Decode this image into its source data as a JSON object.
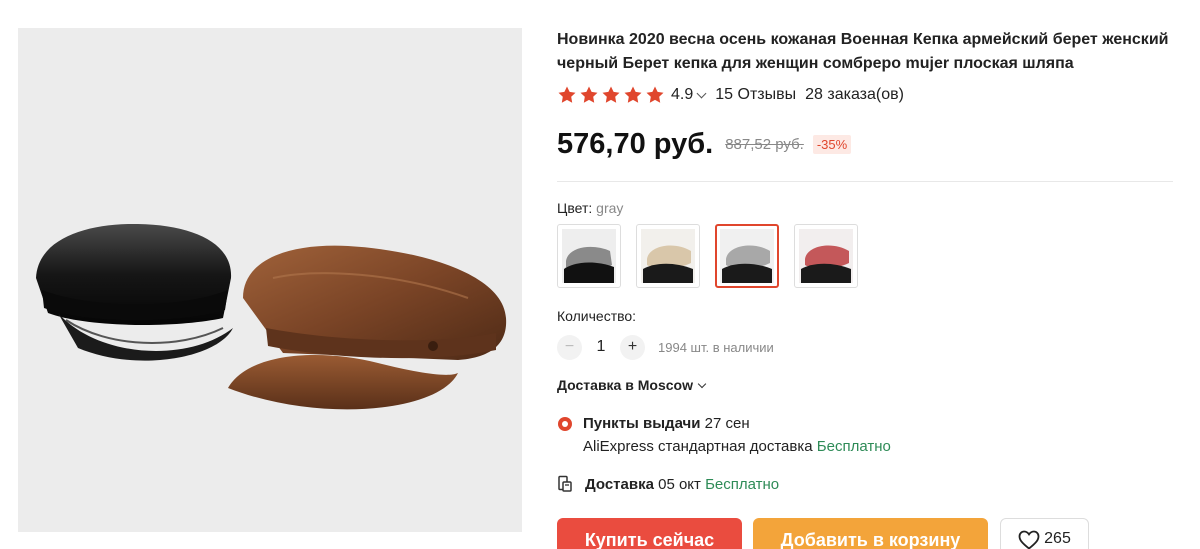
{
  "product": {
    "title": "Новинка 2020 весна осень кожаная Военная Кепка армейский берет женский черный Берет кепка для женщин сомбреро mujer плоская шляпа"
  },
  "rating": {
    "stars": 5,
    "value": "4.9",
    "reviews": "15 Отзывы",
    "orders": "28 заказа(ов)"
  },
  "price": {
    "current": "576,70 руб.",
    "old": "887,52 руб.",
    "discount": "-35%"
  },
  "color": {
    "label": "Цвет:",
    "selected": "gray",
    "options": [
      "black",
      "beige",
      "gray",
      "red"
    ]
  },
  "quantity": {
    "label": "Количество:",
    "value": "1",
    "stock": "1994 шт. в наличии"
  },
  "delivery": {
    "heading": "Доставка в Moscow",
    "pickup_title": "Пункты выдачи",
    "pickup_date": "27 сен",
    "pickup_method": "AliExpress стандартная доставка",
    "pickup_price": "Бесплатно",
    "courier_title": "Доставка",
    "courier_date": "05 окт",
    "courier_price": "Бесплатно"
  },
  "actions": {
    "buy": "Купить сейчас",
    "cart": "Добавить в корзину",
    "wishlist_count": "265"
  },
  "colors": {
    "accent": "#ea4c3f",
    "cart": "#f3a43a",
    "star": "#e0462d",
    "free": "#2e8b57"
  }
}
